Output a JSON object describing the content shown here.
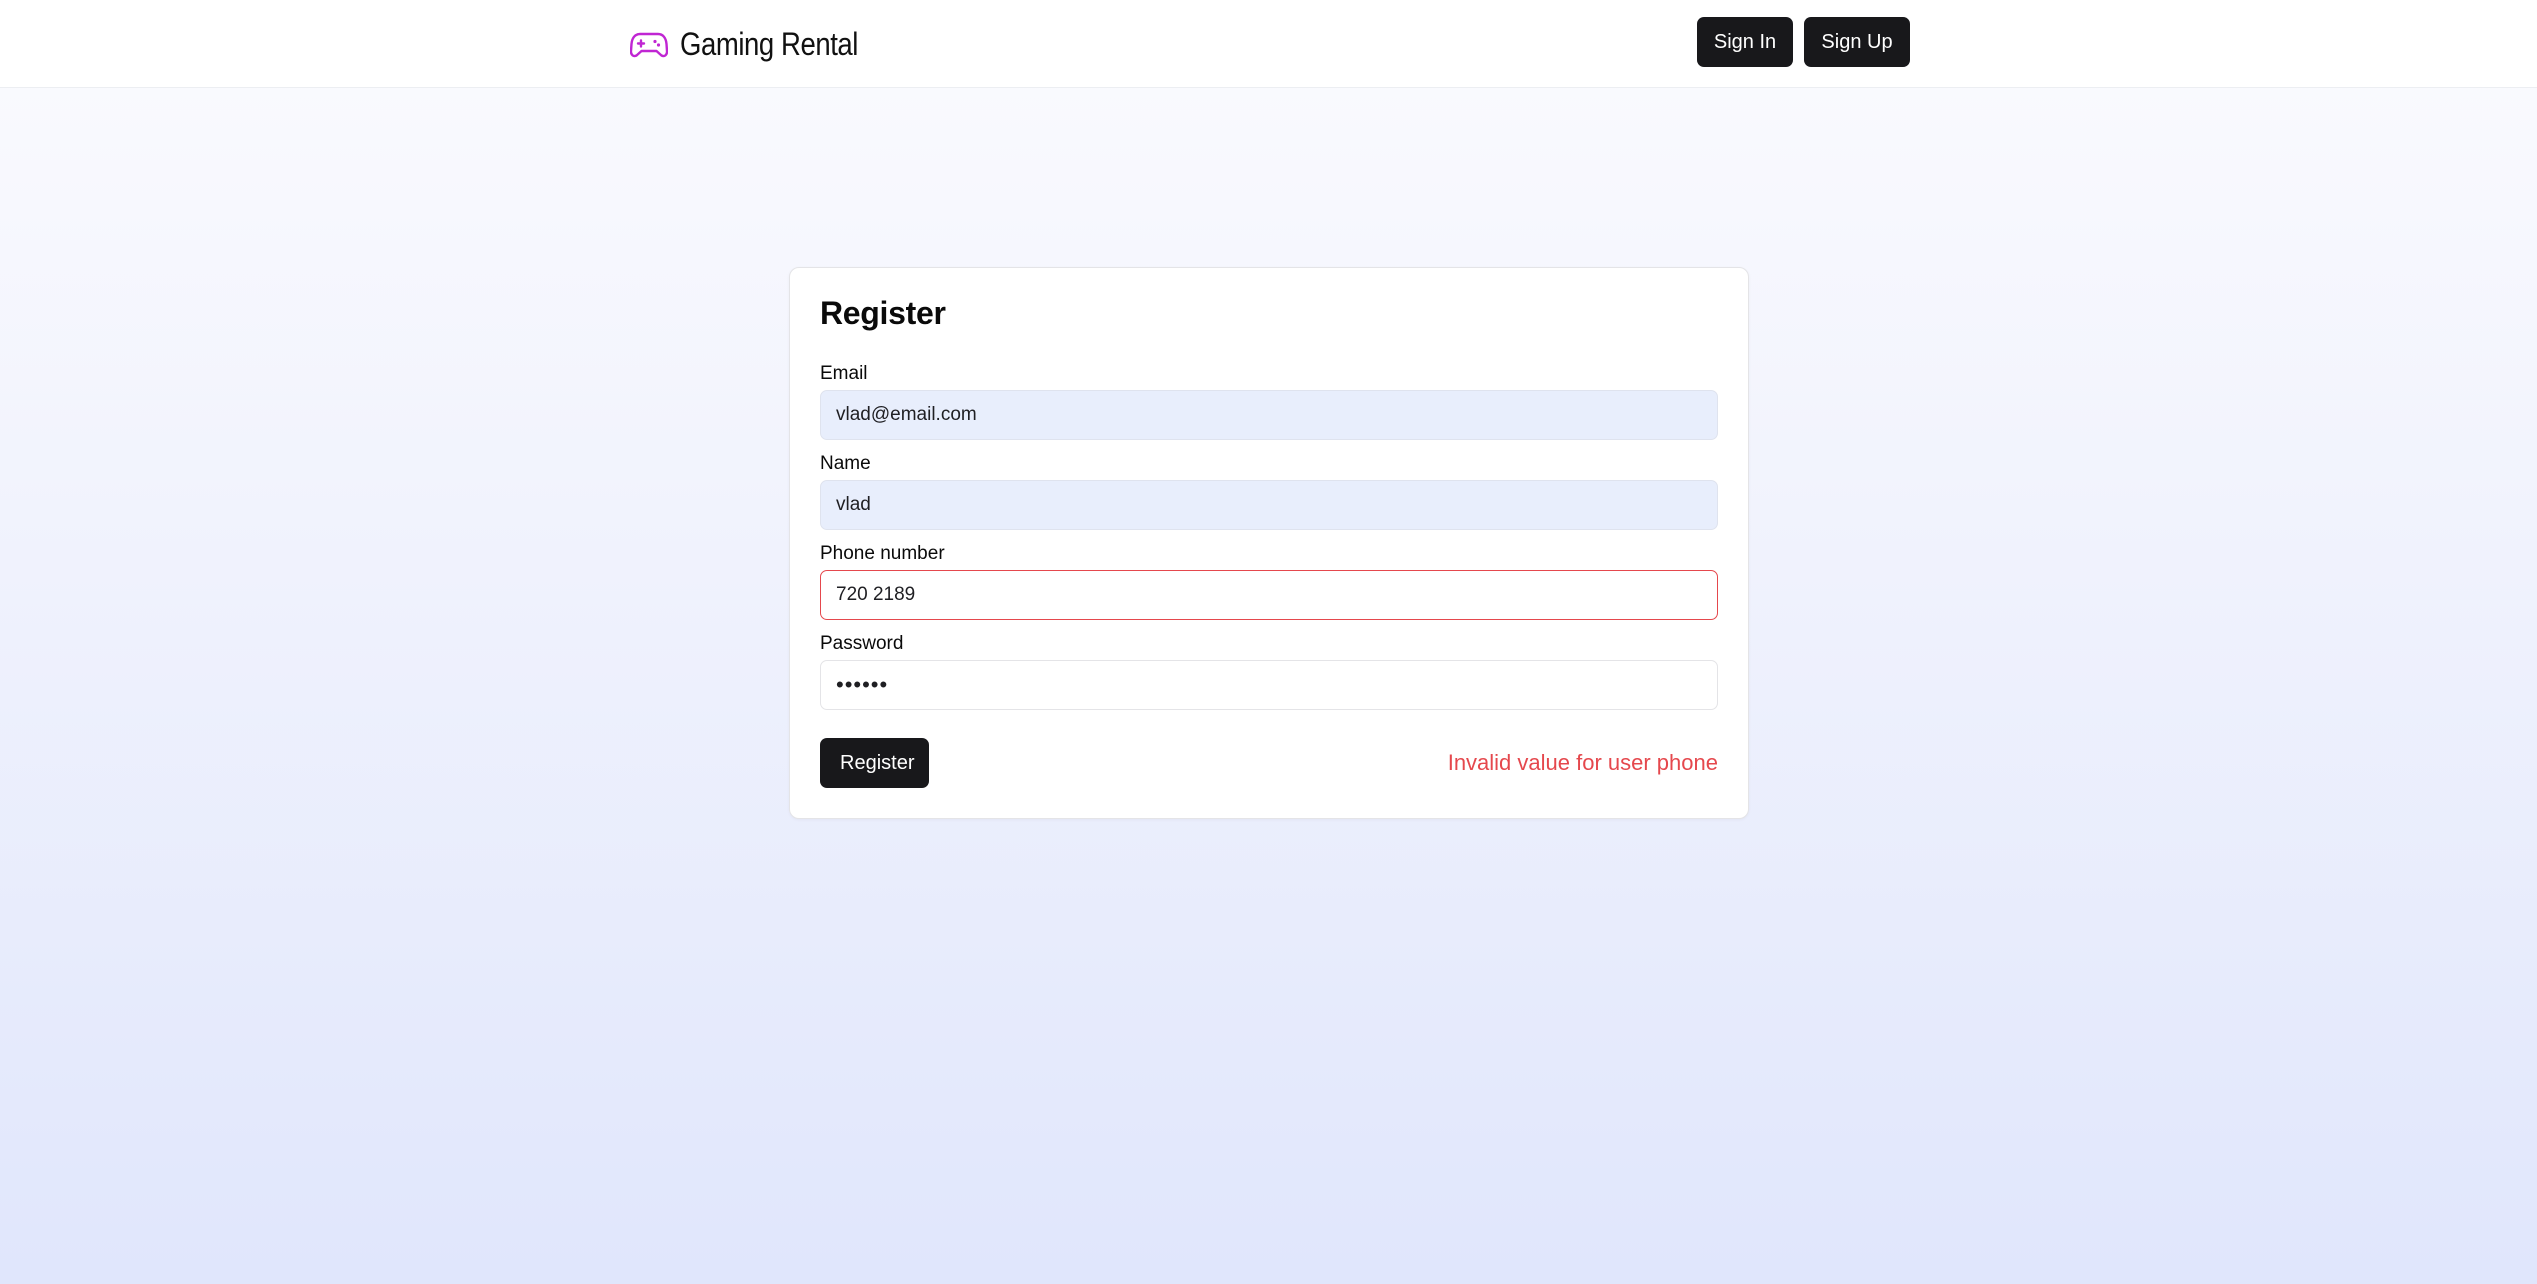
{
  "header": {
    "brand_title": "Gaming Rental",
    "brand_icon": "gamepad-icon",
    "brand_icon_color": "#c026d3",
    "sign_in_label": "Sign In",
    "sign_up_label": "Sign Up"
  },
  "form": {
    "title": "Register",
    "fields": [
      {
        "label": "Email",
        "value": "vlad@email.com",
        "state": "autofilled"
      },
      {
        "label": "Name",
        "value": "vlad",
        "state": "autofilled"
      },
      {
        "label": "Phone number",
        "value": "720 2189",
        "state": "invalid"
      },
      {
        "label": "Password",
        "value": "••••••",
        "state": "default"
      }
    ],
    "submit_label": "Register",
    "error_message": "Invalid value for user phone"
  },
  "colors": {
    "primary_button": "#18181b",
    "error": "#e5484d",
    "autofill_bg": "#e8eefc"
  }
}
